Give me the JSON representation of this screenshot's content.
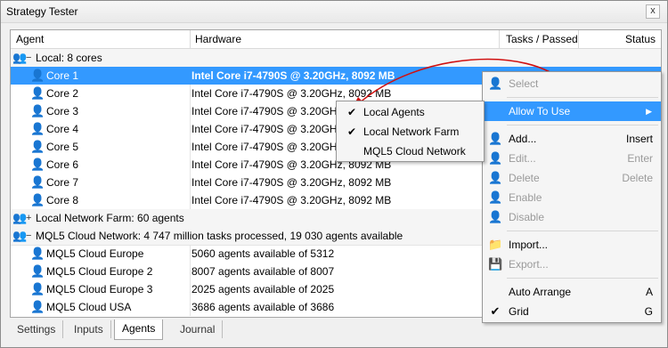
{
  "window": {
    "title": "Strategy Tester",
    "close_label": "x"
  },
  "columns": {
    "agent": "Agent",
    "hardware": "Hardware",
    "tasks": "Tasks / Passed",
    "status": "Status"
  },
  "groups": {
    "local": {
      "label": "Local: 8 cores"
    },
    "farm": {
      "label": "Local Network Farm: 60 agents"
    },
    "cloud": {
      "label": "MQL5 Cloud Network: 4 747 million tasks processed, 19 030 agents available"
    }
  },
  "local_cores": [
    {
      "name": "Core 1",
      "hardware": "Intel Core i7-4790S  @ 3.20GHz, 8092 MB"
    },
    {
      "name": "Core 2",
      "hardware": "Intel Core i7-4790S @ 3.20GHz, 8092 MB"
    },
    {
      "name": "Core 3",
      "hardware": "Intel Core i7-4790S  @ 3.20GHz, 8092 MB"
    },
    {
      "name": "Core 4",
      "hardware": "Intel Core i7-4790S  @ 3.20GHz, 8092 MB"
    },
    {
      "name": "Core 5",
      "hardware": "Intel Core i7-4790S  @ 3.20GHz, 8092 MB"
    },
    {
      "name": "Core 6",
      "hardware": "Intel Core i7-4790S  @ 3.20GHz, 8092 MB"
    },
    {
      "name": "Core 7",
      "hardware": "Intel Core i7-4790S  @ 3.20GHz, 8092 MB"
    },
    {
      "name": "Core 8",
      "hardware": "Intel Core i7-4790S  @ 3.20GHz, 8092 MB"
    }
  ],
  "cloud_agents": [
    {
      "name": "MQL5 Cloud Europe",
      "hardware": "5060 agents available of 5312"
    },
    {
      "name": "MQL5 Cloud Europe 2",
      "hardware": "8007 agents available of 8007"
    },
    {
      "name": "MQL5 Cloud Europe 3",
      "hardware": "2025 agents available of 2025"
    },
    {
      "name": "MQL5 Cloud USA",
      "hardware": "3686 agents available of 3686"
    }
  ],
  "tabs": [
    {
      "label": "Settings"
    },
    {
      "label": "Inputs"
    },
    {
      "label": "Agents"
    },
    {
      "label": "Journal"
    }
  ],
  "context_menu": {
    "select": "Select",
    "allow_to_use": "Allow To Use",
    "add": "Add...",
    "add_key": "Insert",
    "edit": "Edit...",
    "edit_key": "Enter",
    "delete": "Delete",
    "delete_key": "Delete",
    "enable": "Enable",
    "disable": "Disable",
    "import": "Import...",
    "export": "Export...",
    "auto_arrange": "Auto Arrange",
    "auto_arrange_key": "A",
    "grid": "Grid",
    "grid_key": "G"
  },
  "submenu": {
    "local_agents": "Local Agents",
    "local_network_farm": "Local Network Farm",
    "mql5_cloud_network": "MQL5 Cloud Network"
  },
  "icons": {
    "agent": "agent-icon",
    "cloud_agent": "cloud-agent-icon",
    "check": "check-icon",
    "add": "add-icon",
    "folder": "folder-icon",
    "disk": "disk-icon"
  },
  "colors": {
    "selection": "#3399ff",
    "accent_red": "#d01010"
  }
}
